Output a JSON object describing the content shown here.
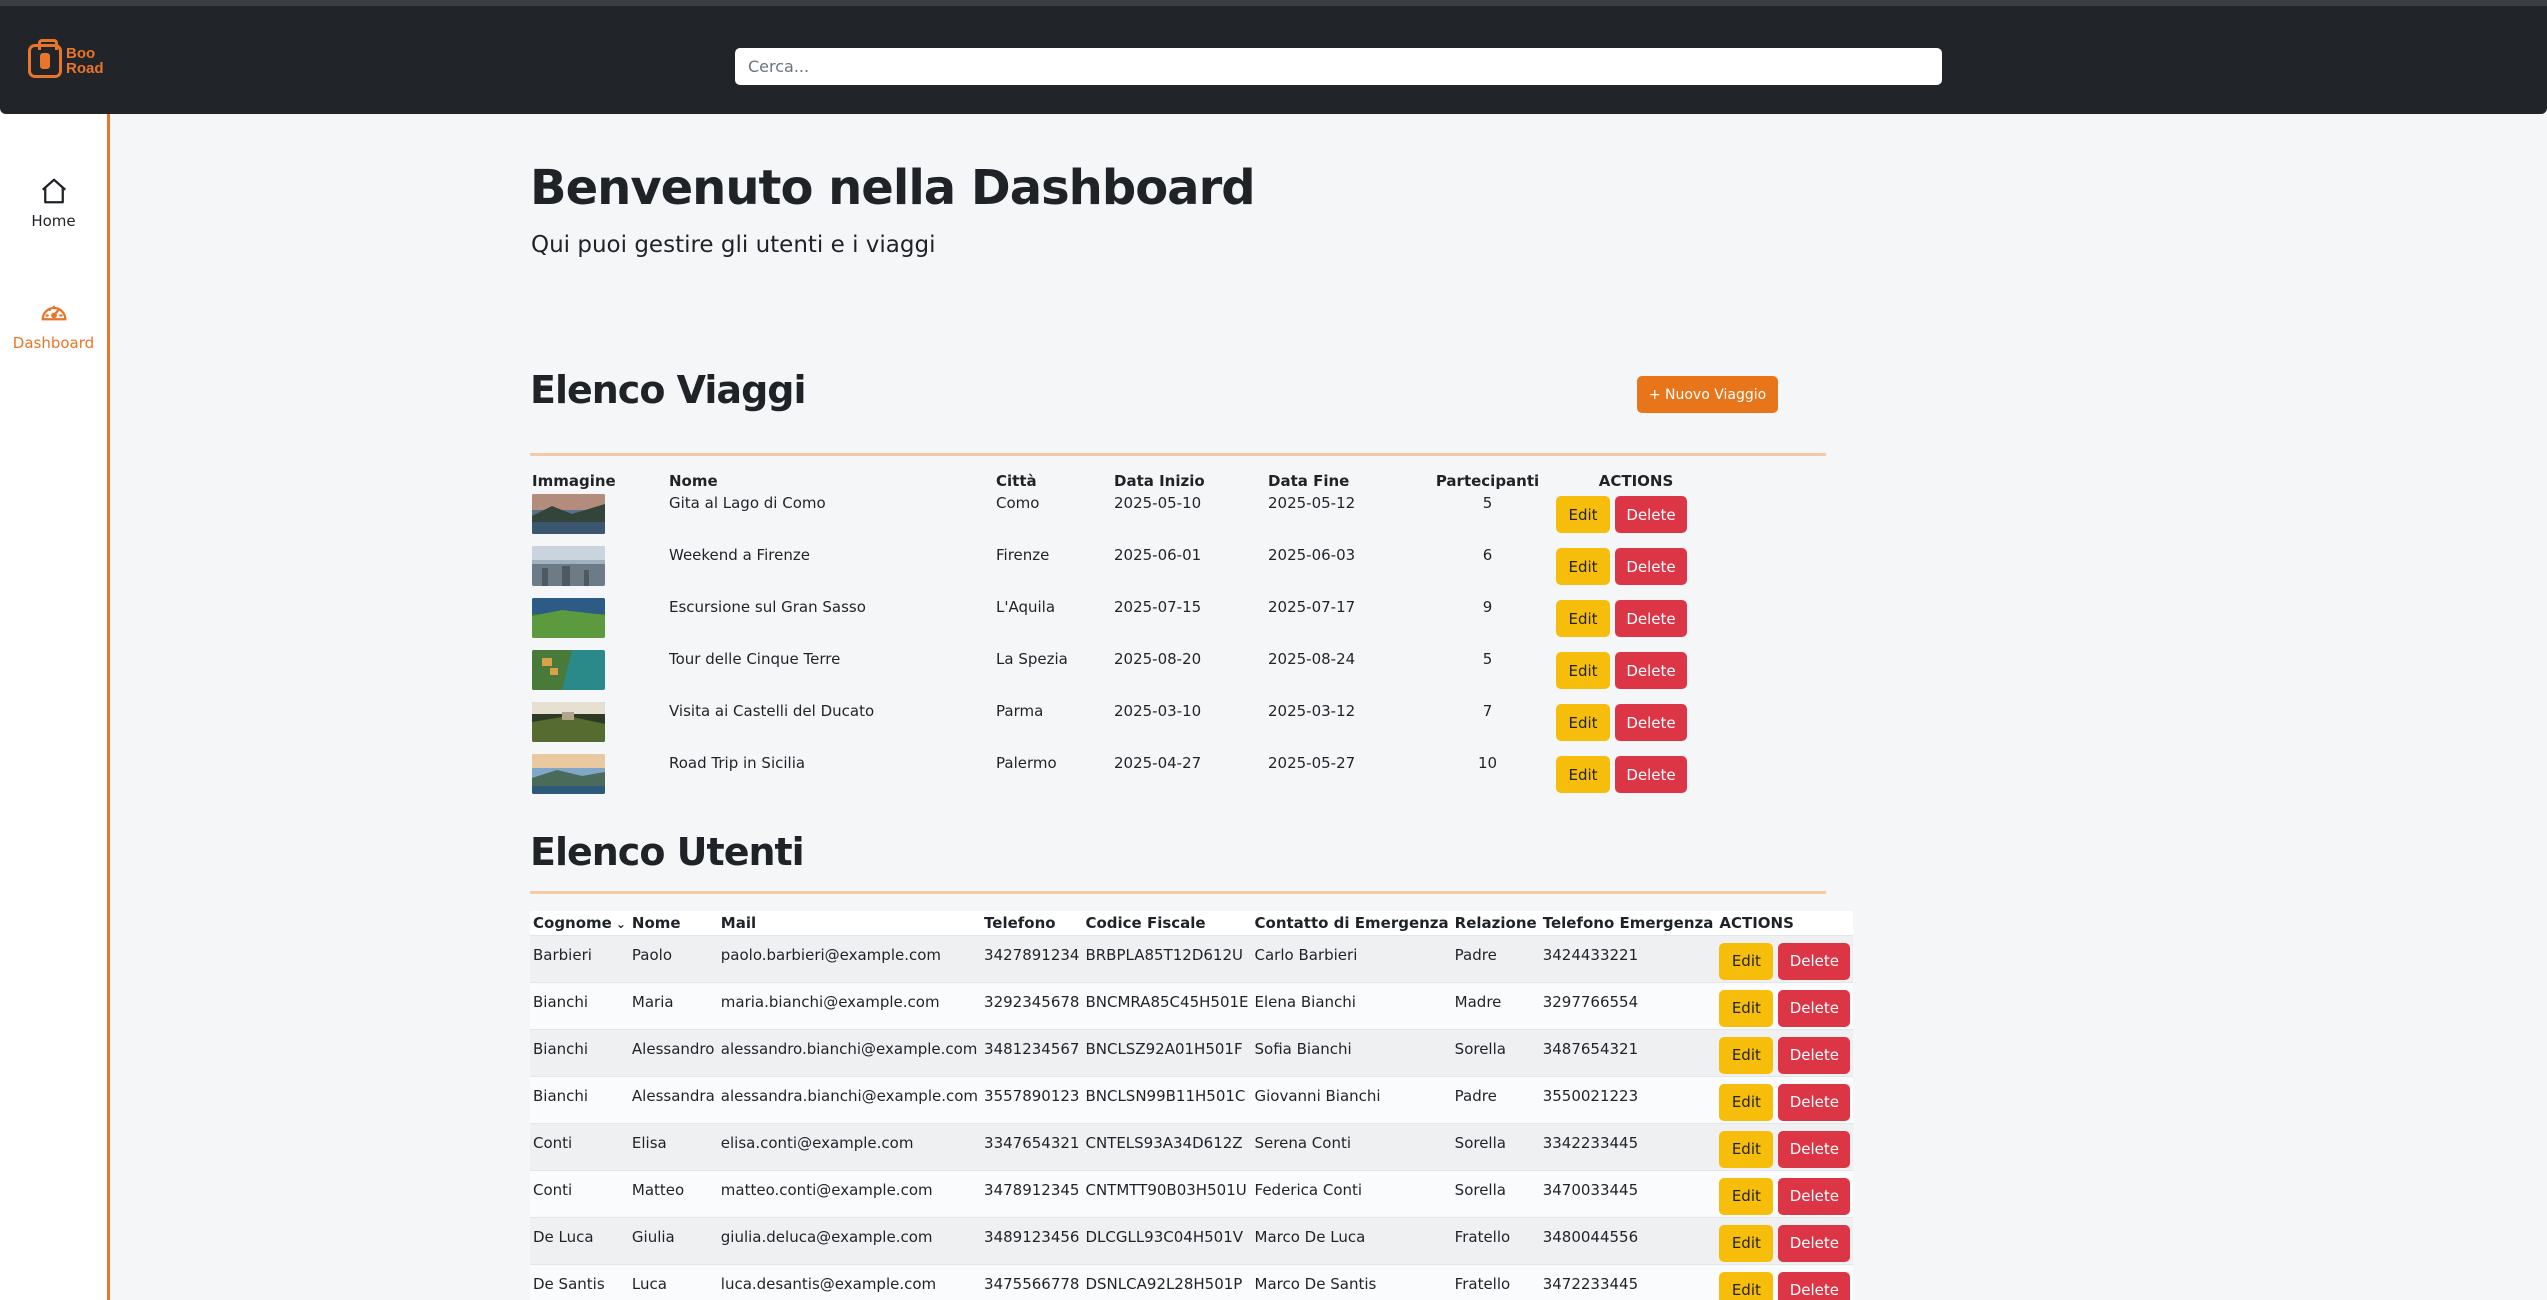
{
  "app": {
    "logo_text_line1": "Boo",
    "logo_text_line2": "Road",
    "search_placeholder": "Cerca..."
  },
  "sidebar": {
    "items": [
      {
        "label": "Home",
        "icon": "home-icon",
        "active": false
      },
      {
        "label": "Dashboard",
        "icon": "dashboard-gauge-icon",
        "active": true
      }
    ]
  },
  "header": {
    "title": "Benvenuto nella Dashboard",
    "subtitle": "Qui puoi gestire gli utenti e i viaggi"
  },
  "colors": {
    "accent": "#e8752a",
    "topbar": "#212529",
    "edit": "#f7bd0b",
    "delete": "#dc3545"
  },
  "trips": {
    "title": "Elenco Viaggi",
    "new_button": "+ Nuovo Viaggio",
    "columns": [
      "Immagine",
      "Nome",
      "Città",
      "Data Inizio",
      "Data Fine",
      "Partecipanti",
      "ACTIONS"
    ],
    "edit_label": "Edit",
    "delete_label": "Delete",
    "rows": [
      {
        "name": "Gita al Lago di Como",
        "city": "Como",
        "start": "2025-05-10",
        "end": "2025-05-12",
        "participants": "5"
      },
      {
        "name": "Weekend a Firenze",
        "city": "Firenze",
        "start": "2025-06-01",
        "end": "2025-06-03",
        "participants": "6"
      },
      {
        "name": "Escursione sul Gran Sasso",
        "city": "L'Aquila",
        "start": "2025-07-15",
        "end": "2025-07-17",
        "participants": "9"
      },
      {
        "name": "Tour delle Cinque Terre",
        "city": "La Spezia",
        "start": "2025-08-20",
        "end": "2025-08-24",
        "participants": "5"
      },
      {
        "name": "Visita ai Castelli del Ducato",
        "city": "Parma",
        "start": "2025-03-10",
        "end": "2025-03-12",
        "participants": "7"
      },
      {
        "name": "Road Trip in Sicilia",
        "city": "Palermo",
        "start": "2025-04-27",
        "end": "2025-05-27",
        "participants": "10"
      }
    ]
  },
  "users": {
    "title": "Elenco Utenti",
    "columns": [
      "Cognome",
      "Nome",
      "Mail",
      "Telefono",
      "Codice Fiscale",
      "Contatto di Emergenza",
      "Relazione",
      "Telefono Emergenza",
      "ACTIONS"
    ],
    "edit_label": "Edit",
    "delete_label": "Delete",
    "rows": [
      {
        "surname": "Barbieri",
        "name": "Paolo",
        "mail": "paolo.barbieri@example.com",
        "phone": "3427891234",
        "cf": "BRBPLA85T12D612U",
        "emergency": "Carlo Barbieri",
        "relation": "Padre",
        "emergency_phone": "3424433221"
      },
      {
        "surname": "Bianchi",
        "name": "Maria",
        "mail": "maria.bianchi@example.com",
        "phone": "3292345678",
        "cf": "BNCMRA85C45H501E",
        "emergency": "Elena Bianchi",
        "relation": "Madre",
        "emergency_phone": "3297766554"
      },
      {
        "surname": "Bianchi",
        "name": "Alessandro",
        "mail": "alessandro.bianchi@example.com",
        "phone": "3481234567",
        "cf": "BNCLSZ92A01H501F",
        "emergency": "Sofia Bianchi",
        "relation": "Sorella",
        "emergency_phone": "3487654321"
      },
      {
        "surname": "Bianchi",
        "name": "Alessandra",
        "mail": "alessandra.bianchi@example.com",
        "phone": "3557890123",
        "cf": "BNCLSN99B11H501C",
        "emergency": "Giovanni Bianchi",
        "relation": "Padre",
        "emergency_phone": "3550021223"
      },
      {
        "surname": "Conti",
        "name": "Elisa",
        "mail": "elisa.conti@example.com",
        "phone": "3347654321",
        "cf": "CNTELS93A34D612Z",
        "emergency": "Serena Conti",
        "relation": "Sorella",
        "emergency_phone": "3342233445"
      },
      {
        "surname": "Conti",
        "name": "Matteo",
        "mail": "matteo.conti@example.com",
        "phone": "3478912345",
        "cf": "CNTMTT90B03H501U",
        "emergency": "Federica Conti",
        "relation": "Sorella",
        "emergency_phone": "3470033445"
      },
      {
        "surname": "De Luca",
        "name": "Giulia",
        "mail": "giulia.deluca@example.com",
        "phone": "3489123456",
        "cf": "DLCGLL93C04H501V",
        "emergency": "Marco De Luca",
        "relation": "Fratello",
        "emergency_phone": "3480044556"
      },
      {
        "surname": "De Santis",
        "name": "Luca",
        "mail": "luca.desantis@example.com",
        "phone": "3475566778",
        "cf": "DSNLCA92L28H501P",
        "emergency": "Marco De Santis",
        "relation": "Fratello",
        "emergency_phone": "3472233445"
      }
    ]
  }
}
